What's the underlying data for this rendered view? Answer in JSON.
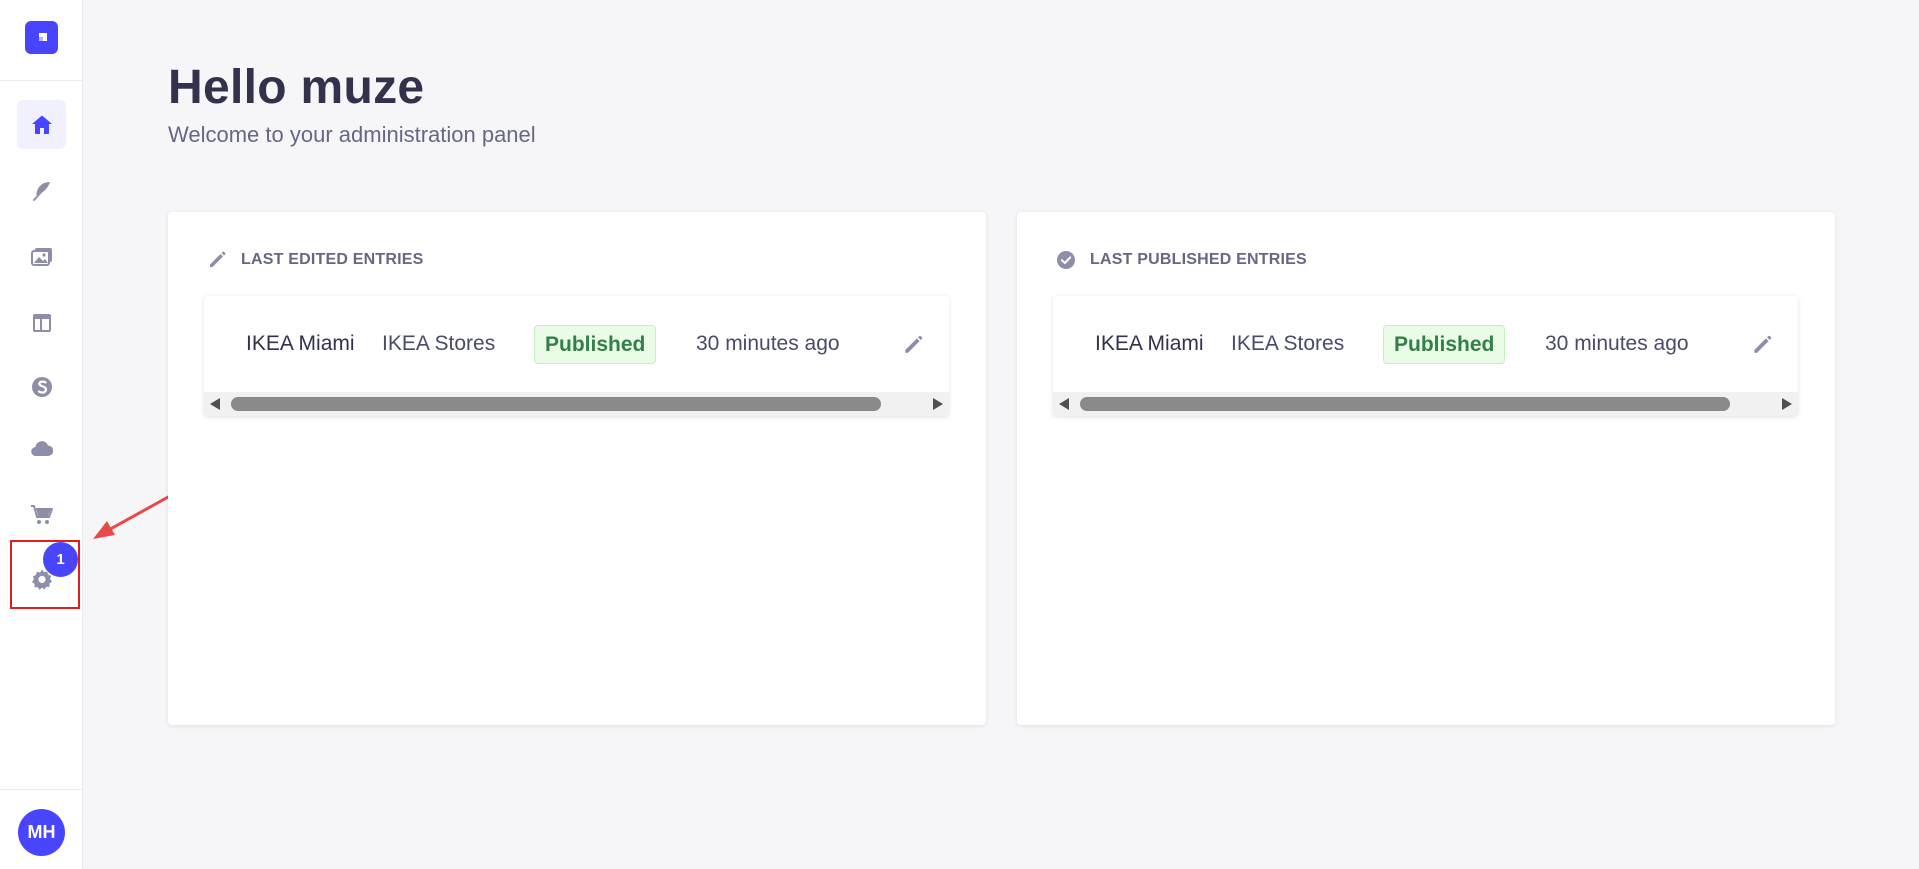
{
  "sidebar": {
    "logo_icon": "strapi-logo-icon",
    "items": [
      {
        "name": "home",
        "icon": "home-icon",
        "active": true
      },
      {
        "name": "content-manager",
        "icon": "feather-icon"
      },
      {
        "name": "media-library",
        "icon": "image-icon"
      },
      {
        "name": "content-type-builder",
        "icon": "layout-icon"
      },
      {
        "name": "plugin-s",
        "icon": "s-logo-icon"
      },
      {
        "name": "cloud",
        "icon": "cloud-icon"
      },
      {
        "name": "marketplace",
        "icon": "cart-icon"
      },
      {
        "name": "settings",
        "icon": "gear-icon"
      }
    ],
    "settings_badge": "1",
    "avatar_initials": "MH"
  },
  "header": {
    "title": "Hello muze",
    "subtitle": "Welcome to your administration panel"
  },
  "cards": {
    "last_edited": {
      "title": "LAST EDITED ENTRIES",
      "icon": "pencil-icon",
      "entries": [
        {
          "name": "IKEA Miami",
          "type": "IKEA Stores",
          "status": "Published",
          "time": "30 minutes ago"
        }
      ]
    },
    "last_published": {
      "title": "LAST PUBLISHED ENTRIES",
      "icon": "check-circle-icon",
      "entries": [
        {
          "name": "IKEA Miami",
          "type": "IKEA Stores",
          "status": "Published",
          "time": "30 minutes ago"
        }
      ]
    }
  },
  "colors": {
    "primary": "#4945ff",
    "success_bg": "#eafbe7",
    "success_text": "#328048",
    "annotation_red": "#e01e1e"
  }
}
